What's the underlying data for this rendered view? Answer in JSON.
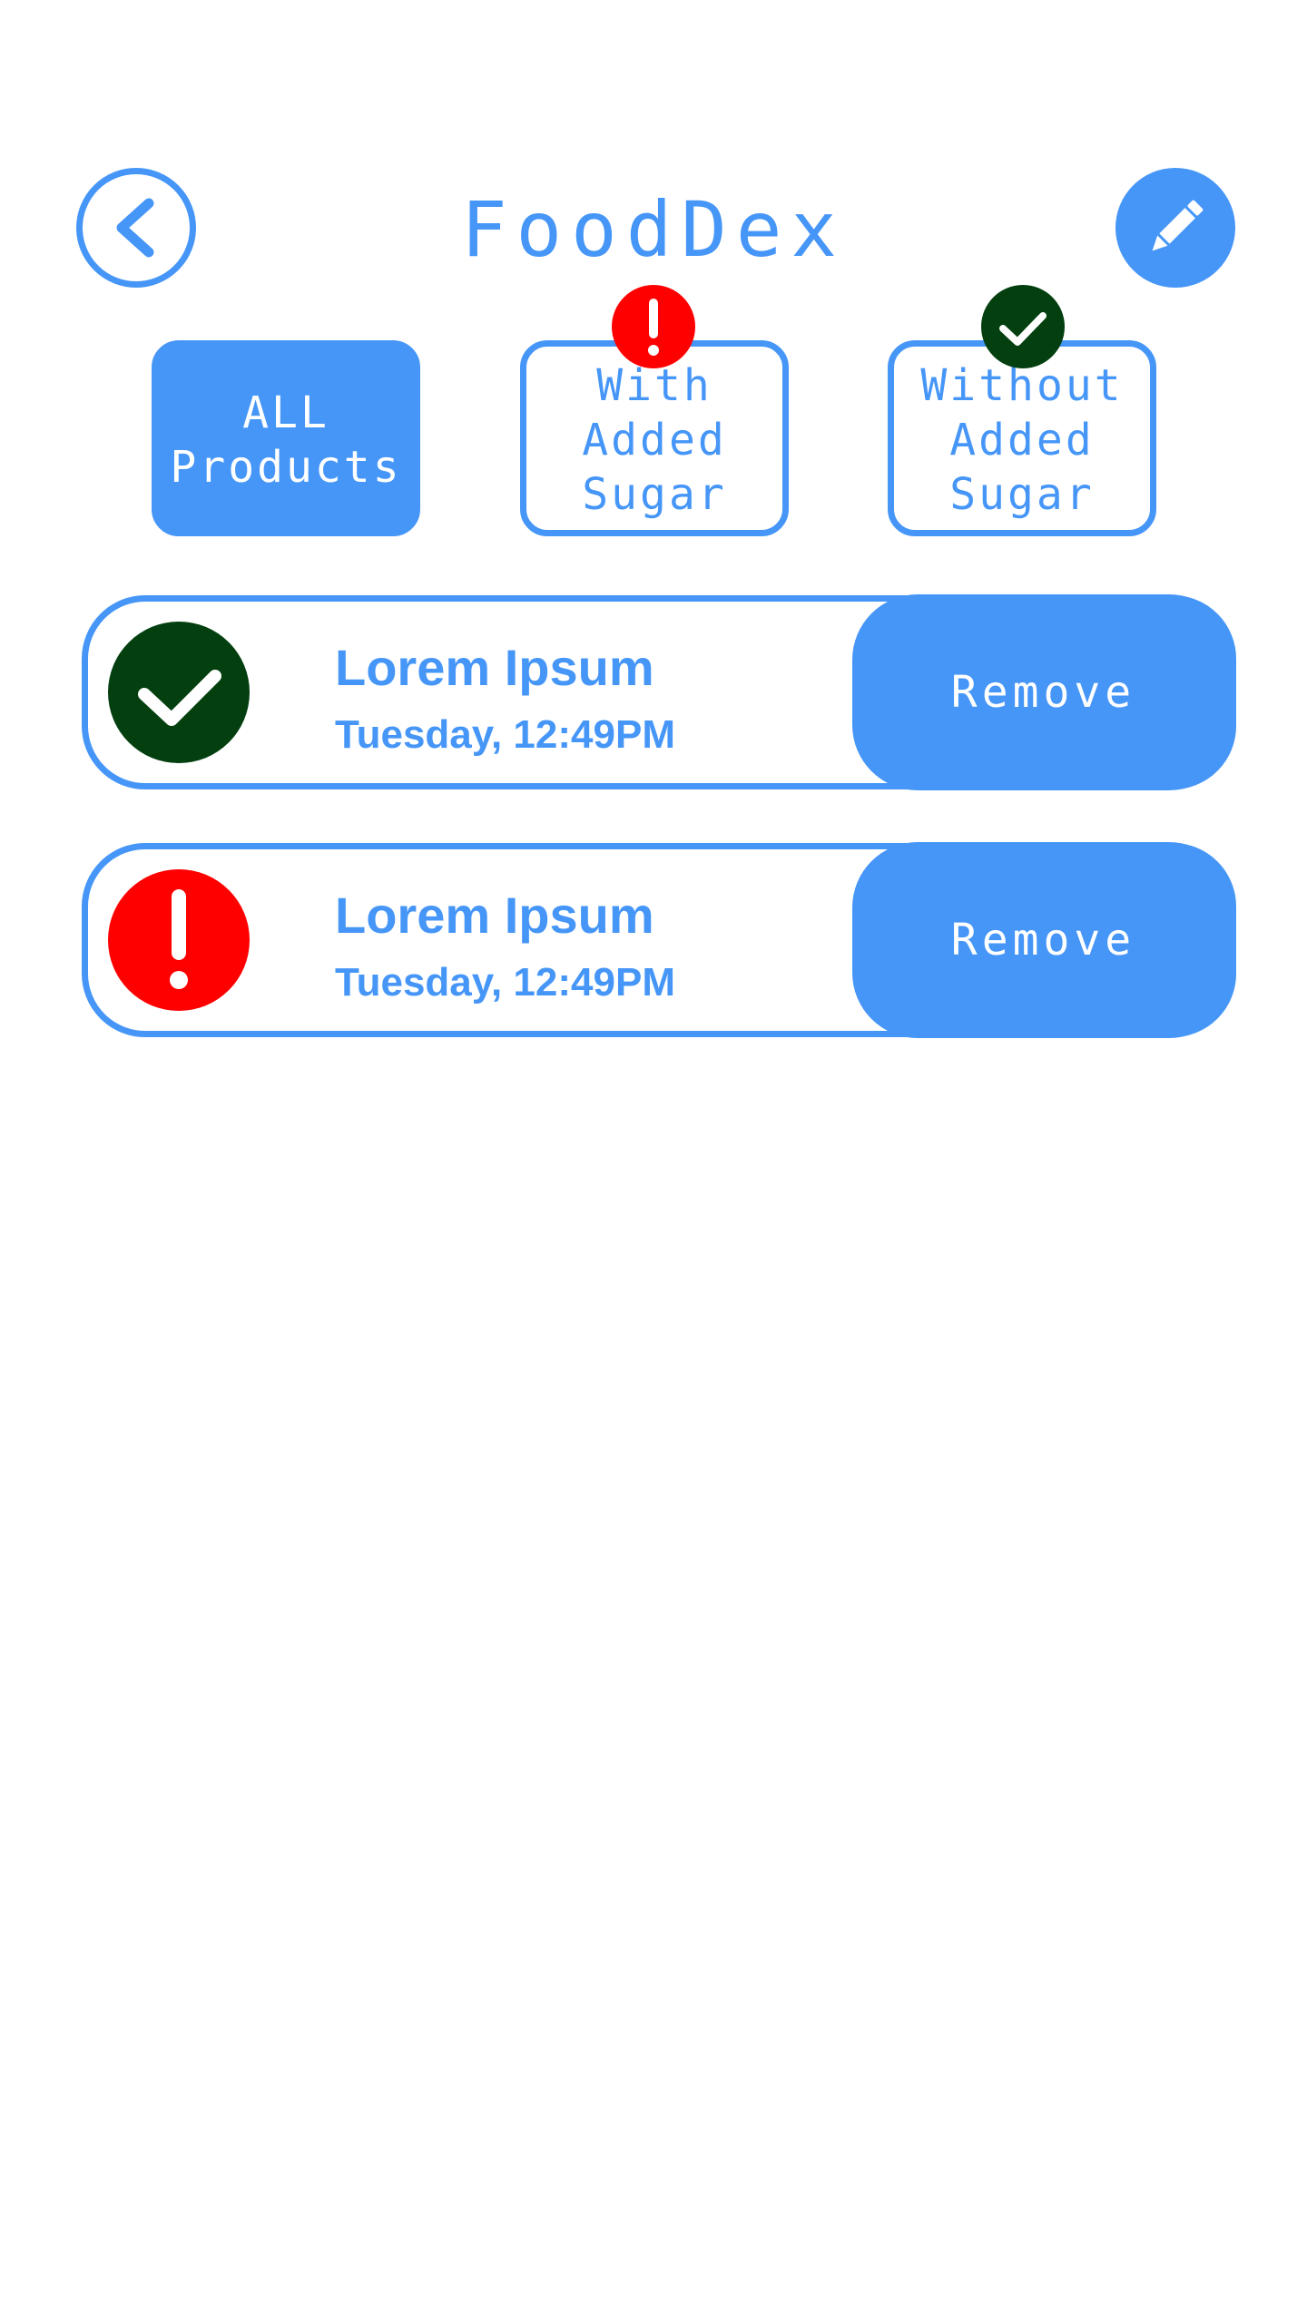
{
  "header": {
    "title": "FoodDex",
    "back_icon": "chevron-left-icon",
    "edit_icon": "pencil-icon"
  },
  "filters": [
    {
      "label": "ALL\nProducts",
      "active": true
    },
    {
      "label": "With\nAdded\nSugar",
      "active": false,
      "badge_icon": "exclamation-icon"
    },
    {
      "label": "Without\nAdded\nSugar",
      "active": false,
      "badge_icon": "checkmark-icon"
    }
  ],
  "products": [
    {
      "name": "Lorem Ipsum",
      "time": "Tuesday, 12:49PM",
      "status_icon": "checkmark-icon",
      "remove_label": "Remove"
    },
    {
      "name": "Lorem Ipsum",
      "time": "Tuesday, 12:49PM",
      "status_icon": "exclamation-icon",
      "remove_label": "Remove"
    }
  ],
  "colors": {
    "primary": "#4696f8",
    "success": "#033f0f",
    "warning": "#fe0000",
    "background": "#ffffff"
  }
}
